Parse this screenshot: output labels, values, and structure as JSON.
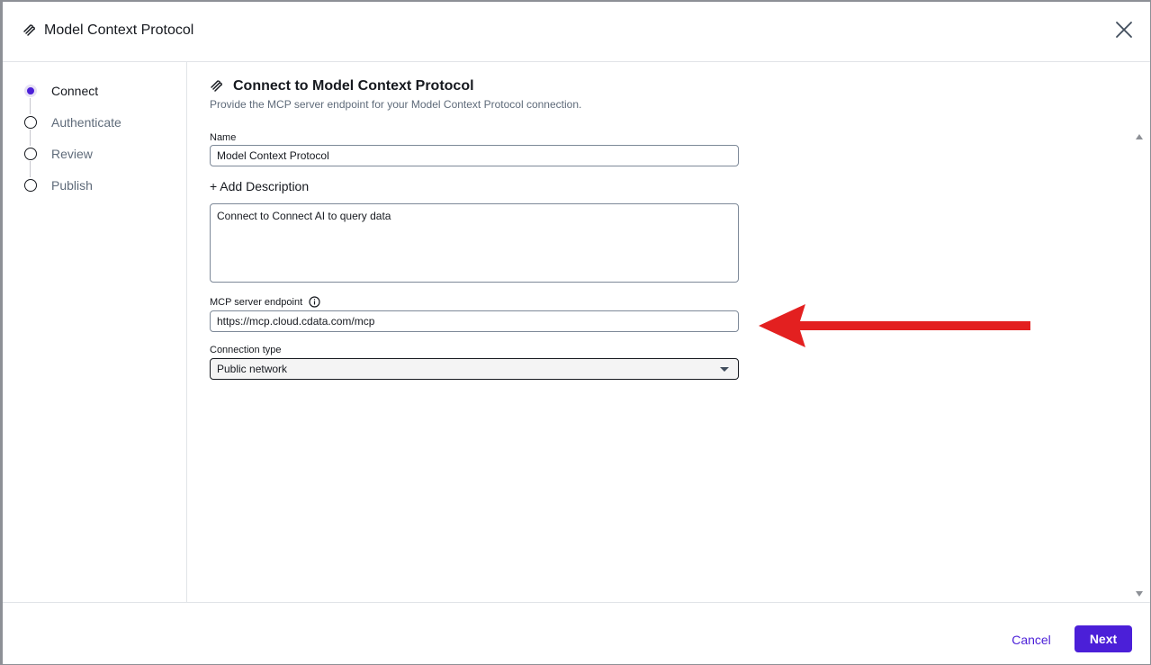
{
  "dialog": {
    "title": "Model Context Protocol",
    "close_icon": "close-icon"
  },
  "steps": [
    {
      "label": "Connect",
      "active": true
    },
    {
      "label": "Authenticate",
      "active": false
    },
    {
      "label": "Review",
      "active": false
    },
    {
      "label": "Publish",
      "active": false
    }
  ],
  "form": {
    "heading": "Connect to Model Context Protocol",
    "subheading": "Provide the MCP server endpoint for your Model Context Protocol connection.",
    "name_label": "Name",
    "name_value": "Model Context Protocol",
    "add_description_label": "+ Add Description",
    "description_value": "Connect to Connect AI to query data",
    "endpoint_label": "MCP server endpoint",
    "endpoint_value": "https://mcp.cloud.cdata.com/mcp",
    "connection_type_label": "Connection type",
    "connection_type_value": "Public network"
  },
  "footer": {
    "cancel_label": "Cancel",
    "next_label": "Next"
  },
  "colors": {
    "accent": "#4b1fd8",
    "annotation_arrow": "#e32020"
  }
}
